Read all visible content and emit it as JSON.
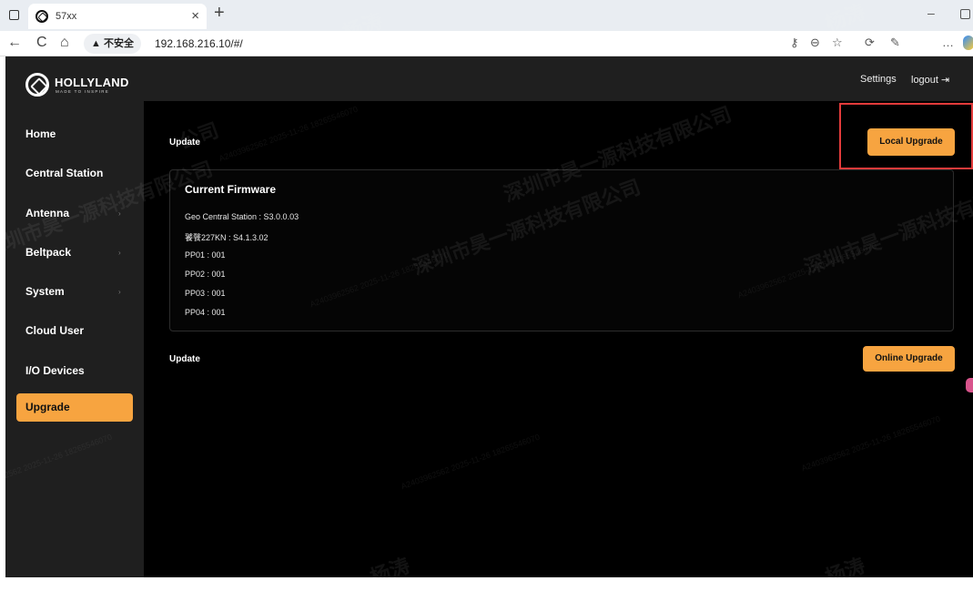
{
  "browser": {
    "tab_title": "57xx",
    "tab_close": "×",
    "new_tab": "+",
    "minimize": "–",
    "back": "←",
    "reload": "C",
    "home": "⌂",
    "insecure_label": "▲ 不安全",
    "url": "192.168.216.10/#/",
    "more": "…"
  },
  "sidebar": {
    "logo_text": "HOLLYLAND",
    "logo_tagline": "MADE TO INSPIRE",
    "items": [
      {
        "label": "Home",
        "has_arrow": false
      },
      {
        "label": "Central Station",
        "has_arrow": false
      },
      {
        "label": "Antenna",
        "has_arrow": true
      },
      {
        "label": "Beltpack",
        "has_arrow": true
      },
      {
        "label": "System",
        "has_arrow": true
      },
      {
        "label": "Cloud User",
        "has_arrow": false
      },
      {
        "label": "I/O Devices",
        "has_arrow": false
      },
      {
        "label": "Upgrade",
        "has_arrow": false,
        "active": true
      }
    ],
    "arrow_glyph": "›"
  },
  "topbar": {
    "settings": "Settings",
    "logout": "logout ⇥"
  },
  "main": {
    "local_section_label": "Update",
    "local_upgrade_button": "Local Upgrade",
    "firmware": {
      "title": "Current Firmware",
      "lines": [
        "Geo Central Station : S3.0.0.03",
        "饕餮227KN : S4.1.3.02",
        "PP01 : 001",
        "PP02 : 001",
        "PP03 : 001",
        "PP04 : 001"
      ]
    },
    "online_section_label": "Update",
    "online_upgrade_button": "Online Upgrade"
  },
  "watermark": {
    "name": "杨涛",
    "company": "深圳市昊一源科技有限公司",
    "company_short": "公司",
    "code": "A2403962562 2025-11-26 18265546070"
  },
  "colors": {
    "accent": "#f7a440",
    "highlight": "#e23b3b",
    "sidebar_bg": "#1f1f1f",
    "main_bg": "#000000"
  }
}
